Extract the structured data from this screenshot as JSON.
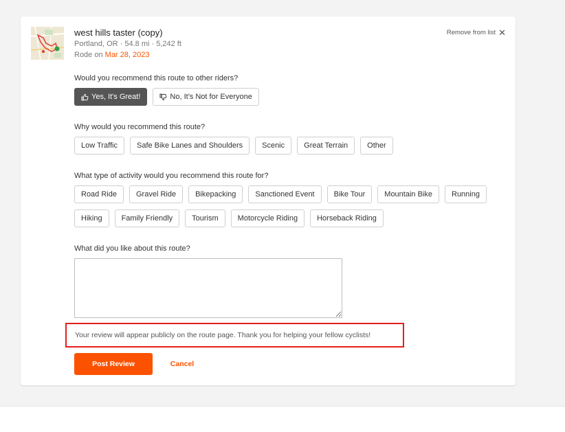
{
  "route": {
    "title": "west hills taster (copy)",
    "meta": "Portland, OR · 54.8 mi · 5,242 ft",
    "rode_prefix": "Rode on ",
    "rode_date": "Mar 28, 2023",
    "remove_label": "Remove from list"
  },
  "recommend": {
    "question": "Would you recommend this route to other riders?",
    "yes_label": "Yes, It's Great!",
    "no_label": "No, It's Not for Everyone",
    "selected": "yes"
  },
  "reasons": {
    "question": "Why would you recommend this route?",
    "options": [
      "Low Traffic",
      "Safe Bike Lanes and Shoulders",
      "Scenic",
      "Great Terrain",
      "Other"
    ]
  },
  "activity": {
    "question": "What type of activity would you recommend this route for?",
    "row1": [
      "Road Ride",
      "Gravel Ride",
      "Bikepacking",
      "Sanctioned Event",
      "Bike Tour",
      "Mountain Bike",
      "Running"
    ],
    "row2": [
      "Hiking",
      "Family Friendly",
      "Tourism",
      "Motorcycle Riding",
      "Horseback Riding"
    ]
  },
  "comment": {
    "question": "What did you like about this route?",
    "value": ""
  },
  "notice": "Your review will appear publicly on the route page. Thank you for helping your fellow cyclists!",
  "actions": {
    "post_label": "Post Review",
    "cancel_label": "Cancel"
  },
  "colors": {
    "accent": "#fc5200",
    "selected_chip": "#555555",
    "notice_border": "#e41e1e"
  }
}
